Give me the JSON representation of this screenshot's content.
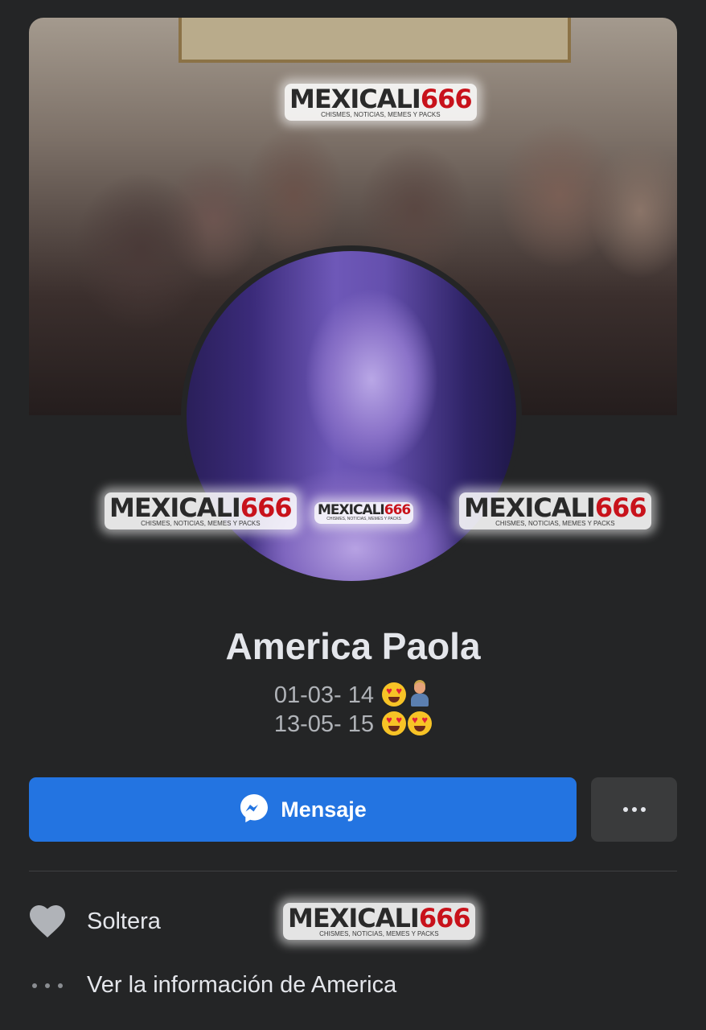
{
  "profile": {
    "name": "America Paola",
    "bio_line1": "01-03- 14",
    "bio_line2": "13-05- 15",
    "bio_line1_emojis": [
      "heart-eyes-emoji",
      "woman-with-child-emoji"
    ],
    "bio_line2_emojis": [
      "heart-eyes-emoji",
      "heart-eyes-emoji"
    ]
  },
  "watermark": {
    "brand_a": "MEXICALI",
    "brand_b": "666",
    "tagline": "CHISMES, NOTICIAS, MEMES Y PACKS"
  },
  "actions": {
    "message_label": "Mensaje",
    "message_icon": "messenger-icon",
    "more_icon": "more-options-icon"
  },
  "details": [
    {
      "icon": "heart-icon",
      "label": "Soltera"
    },
    {
      "icon": "more-dots-icon",
      "label": "Ver la información de America"
    }
  ],
  "colors": {
    "background": "#242526",
    "primary_button": "#2374e1",
    "secondary_button": "#3a3b3c",
    "text": "#e4e6eb",
    "secondary_text": "#b0b3b8",
    "watermark_red": "#c8121b"
  }
}
